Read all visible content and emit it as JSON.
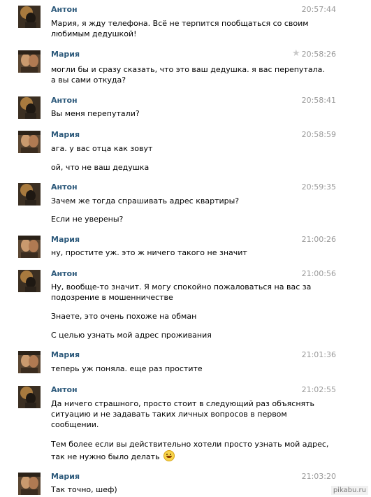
{
  "users": {
    "anton": "Антон",
    "maria": "Мария"
  },
  "messages": [
    {
      "author": "Антон",
      "time": "20:57:44",
      "lines": [
        "Мария, я жду телефона. Всё не терпится пообщаться со своим",
        "любимым дедушкой!"
      ]
    },
    {
      "author": "Мария",
      "time": "20:58:26",
      "lines": [
        "могли бы и сразу сказать, что это ваш дедушка. я вас перепутала.",
        "а вы сами откуда?"
      ]
    },
    {
      "author": "Антон",
      "time": "20:58:41",
      "lines": [
        "Вы меня перепутали?"
      ]
    },
    {
      "author": "Мария",
      "time": "20:58:59",
      "lines": [
        "ага. у вас отца как зовут",
        "ой, что не ваш дедушка"
      ]
    },
    {
      "author": "Антон",
      "time": "20:59:35",
      "lines": [
        "Зачем же тогда спрашивать адрес квартиры?",
        "Если не уверены?"
      ]
    },
    {
      "author": "Мария",
      "time": "21:00:26",
      "lines": [
        "ну, простите уж. это ж ничего такого не значит"
      ]
    },
    {
      "author": "Антон",
      "time": "21:00:56",
      "lines": [
        "Ну, вообще-то значит. Я могу спокойно пожаловаться на вас за",
        "подозрение в мошенничестве",
        "Знаете, это очень похоже на обман",
        "С целью узнать мой адрес проживания"
      ]
    },
    {
      "author": "Мария",
      "time": "21:01:36",
      "lines": [
        "теперь уж поняла. еще раз простите"
      ]
    },
    {
      "author": "Антон",
      "time": "21:02:55",
      "lines": [
        "Да ничего страшного, просто стоит в следующий раз объяснять",
        "ситуацию и не задавать таких личных вопросов в первом",
        "сообщении.",
        "Тем более если вы действительно хотели просто узнать мой адрес,",
        "так не нужно было делать"
      ]
    },
    {
      "author": "Мария",
      "time": "21:03:20",
      "lines": [
        "Так точно, шеф)"
      ]
    }
  ],
  "watermark": "pikabu.ru",
  "icons": {
    "star": "star-icon",
    "emoji": "laughing-emoji-icon"
  },
  "colors": {
    "name": "#2b587a",
    "time": "#999999",
    "text": "#000000"
  }
}
